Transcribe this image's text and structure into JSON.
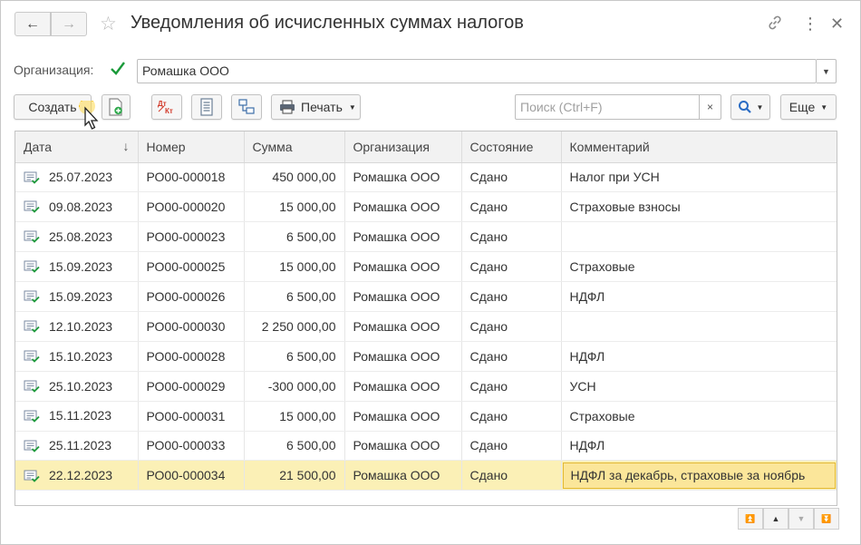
{
  "window": {
    "title": "Уведомления об исчисленных суммах налогов",
    "back_icon": "arrow-left",
    "forward_icon": "arrow-right",
    "favorite_icon": "star",
    "link_icon": "link",
    "menu_icon": "more-vert",
    "close_icon": "close"
  },
  "filter": {
    "org_label": "Организация:",
    "org_checked": true,
    "org_value": "Ромашка ООО"
  },
  "toolbar": {
    "create_label": "Создать",
    "print_label": "Печать",
    "search_placeholder": "Поиск (Ctrl+F)",
    "more_label": "Еще",
    "clear_glyph": "×"
  },
  "table": {
    "columns": [
      "Дата",
      "Номер",
      "Сумма",
      "Организация",
      "Состояние",
      "Комментарий"
    ],
    "sort_indicator": "↓",
    "rows": [
      {
        "date": "25.07.2023",
        "number": "РО00-000018",
        "sum": "450 000,00",
        "org": "Ромашка ООО",
        "status": "Сдано",
        "comment": "Налог при УСН"
      },
      {
        "date": "09.08.2023",
        "number": "РО00-000020",
        "sum": "15 000,00",
        "org": "Ромашка ООО",
        "status": "Сдано",
        "comment": "Страховые взносы"
      },
      {
        "date": "25.08.2023",
        "number": "РО00-000023",
        "sum": "6 500,00",
        "org": "Ромашка ООО",
        "status": "Сдано",
        "comment": ""
      },
      {
        "date": "15.09.2023",
        "number": "РО00-000025",
        "sum": "15 000,00",
        "org": "Ромашка ООО",
        "status": "Сдано",
        "comment": "Страховые"
      },
      {
        "date": "15.09.2023",
        "number": "РО00-000026",
        "sum": "6 500,00",
        "org": "Ромашка ООО",
        "status": "Сдано",
        "comment": "НДФЛ"
      },
      {
        "date": "12.10.2023",
        "number": "РО00-000030",
        "sum": "2 250 000,00",
        "org": "Ромашка ООО",
        "status": "Сдано",
        "comment": ""
      },
      {
        "date": "15.10.2023",
        "number": "РО00-000028",
        "sum": "6 500,00",
        "org": "Ромашка ООО",
        "status": "Сдано",
        "comment": "НДФЛ"
      },
      {
        "date": "25.10.2023",
        "number": "РО00-000029",
        "sum": "-300 000,00",
        "org": "Ромашка ООО",
        "status": "Сдано",
        "comment": "УСН"
      },
      {
        "date": "15.11.2023",
        "number": "РО00-000031",
        "sum": "15 000,00",
        "org": "Ромашка ООО",
        "status": "Сдано",
        "comment": "Страховые"
      },
      {
        "date": "25.11.2023",
        "number": "РО00-000033",
        "sum": "6 500,00",
        "org": "Ромашка ООО",
        "status": "Сдано",
        "comment": "НДФЛ"
      },
      {
        "date": "22.12.2023",
        "number": "РО00-000034",
        "sum": "21 500,00",
        "org": "Ромашка ООО",
        "status": "Сдано",
        "comment": "НДФЛ за декабрь, страховые за ноябрь"
      }
    ],
    "selected_row_index": 10
  },
  "colors": {
    "selected_row_bg": "#fbf0b6",
    "active_cell_bg": "#fbe69a",
    "active_cell_border": "#e2b834",
    "check_green": "#1a9a3a",
    "header_bg": "#f2f2f2"
  }
}
